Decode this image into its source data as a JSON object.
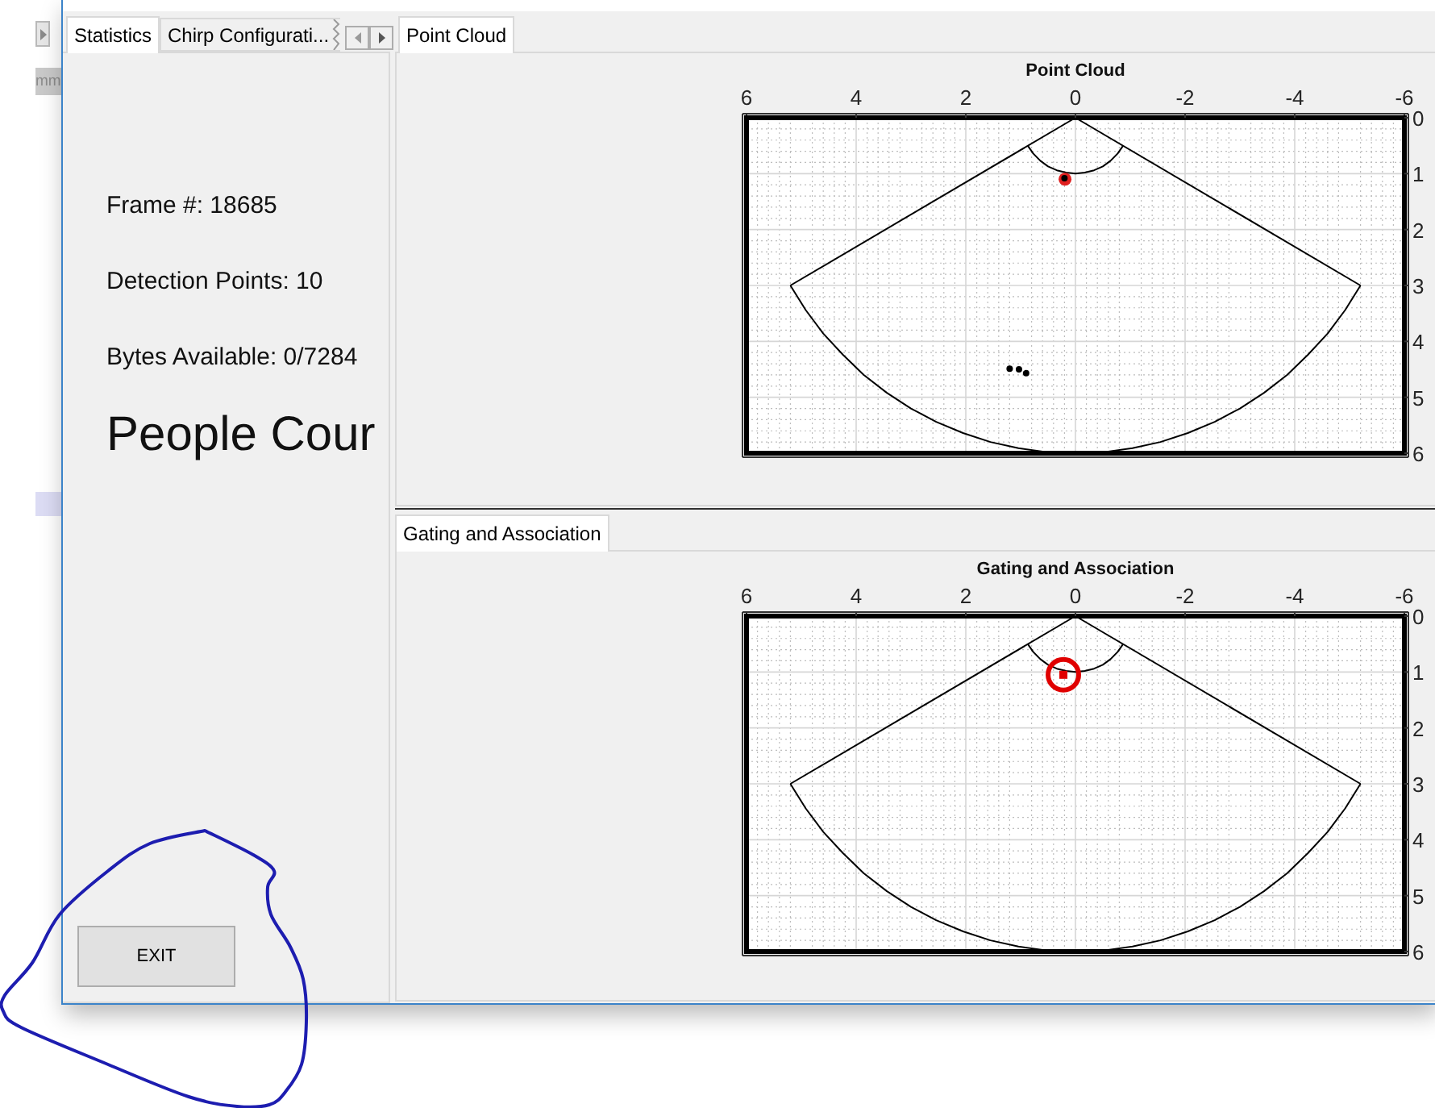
{
  "background_window": {
    "button": {
      "label": "mm"
    },
    "list_row": {
      "selected": true
    }
  },
  "left_panel": {
    "tabs": [
      {
        "label": "Statistics",
        "selected": true,
        "clipped": false
      },
      {
        "label": "Chirp Configurati...",
        "selected": false,
        "clipped": true
      }
    ],
    "stats": [
      {
        "kind": "line",
        "text": "Frame #: 18685"
      },
      {
        "kind": "line",
        "text": "Detection Points: 10"
      },
      {
        "kind": "line",
        "text": "Bytes Available: 0/7284"
      },
      {
        "kind": "heading",
        "text": "People Cour"
      }
    ],
    "exit_button": {
      "label": "EXIT"
    }
  },
  "panels": [
    {
      "tabs": [
        {
          "label": "Point Cloud",
          "selected": true
        }
      ],
      "chart_data": {
        "type": "scatter",
        "title": "Point Cloud",
        "x": [
          0.19,
          1.2,
          1.03,
          0.9,
          0.2,
          0,
          5.2,
          5.2,
          4.92,
          4.6,
          4.24,
          3.86,
          3.44,
          3,
          2.54,
          2.05,
          1.55,
          1.04,
          0.52,
          0,
          -0.52,
          -1.04,
          -1.55,
          -2.05,
          -2.54,
          -3,
          -3.44,
          -3.86,
          -4.24,
          -4.6,
          -4.92,
          -5.2,
          -5.2,
          0,
          0.87,
          0.77,
          0.64,
          0.5,
          0.34,
          0.17,
          0,
          -0.17,
          -0.34,
          -0.5,
          -0.64,
          -0.77,
          -0.87
        ],
        "xlim": [
          6,
          -6
        ],
        "ylim": [
          6,
          0
        ],
        "xticks": [
          6,
          4,
          2,
          0,
          -2,
          -4,
          -6
        ],
        "yticks": [
          0,
          1,
          2,
          3,
          4,
          5,
          6
        ],
        "grid": true,
        "series": [
          {
            "type": "line",
            "color": "#000000",
            "values": [
              null,
              null,
              null,
              null,
              null,
              0,
              3,
              null,
              null,
              null,
              null,
              null,
              null,
              null,
              null,
              null,
              null,
              null,
              null,
              null,
              null,
              null,
              null,
              null,
              null,
              null,
              null,
              null,
              null,
              null,
              null,
              null,
              null,
              null,
              null,
              null,
              null,
              null,
              null,
              null,
              null,
              null,
              null,
              null,
              null,
              null,
              null
            ]
          },
          {
            "type": "line",
            "color": "#000000",
            "values": [
              null,
              null,
              null,
              null,
              null,
              null,
              null,
              3,
              3.44,
              3.86,
              4.24,
              4.6,
              4.92,
              5.2,
              5.44,
              5.64,
              5.8,
              5.91,
              5.98,
              6,
              5.98,
              5.91,
              5.8,
              5.64,
              5.44,
              5.2,
              4.92,
              4.6,
              4.24,
              3.86,
              3.44,
              3,
              null,
              null,
              null,
              null,
              null,
              null,
              null,
              null,
              null,
              null,
              null,
              null,
              null,
              null,
              null
            ]
          },
          {
            "type": "line",
            "color": "#000000",
            "values": [
              null,
              null,
              null,
              null,
              null,
              null,
              null,
              null,
              null,
              null,
              null,
              null,
              null,
              null,
              null,
              null,
              null,
              null,
              null,
              null,
              null,
              null,
              null,
              null,
              null,
              null,
              null,
              null,
              null,
              null,
              null,
              null,
              3,
              0,
              null,
              null,
              null,
              null,
              null,
              null,
              null,
              null,
              null,
              null,
              null,
              null,
              null
            ]
          },
          {
            "type": "line",
            "color": "#000000",
            "values": [
              null,
              null,
              null,
              null,
              null,
              null,
              null,
              null,
              null,
              null,
              null,
              null,
              null,
              null,
              null,
              null,
              null,
              null,
              null,
              null,
              null,
              null,
              null,
              null,
              null,
              null,
              null,
              null,
              null,
              null,
              null,
              null,
              null,
              null,
              0.5,
              0.64,
              0.77,
              0.87,
              0.94,
              0.98,
              1,
              0.98,
              0.94,
              0.87,
              0.77,
              0.64,
              0.5
            ]
          },
          {
            "color": "#e02020",
            "marker": "circle",
            "values": [
              1.1,
              null,
              null,
              null,
              null,
              null,
              null,
              null,
              null,
              null,
              null,
              null,
              null,
              null,
              null,
              null,
              null,
              null,
              null,
              null,
              null,
              null,
              null,
              null,
              null,
              null,
              null,
              null,
              null,
              null,
              null,
              null,
              null,
              null,
              null,
              null,
              null,
              null,
              null,
              null,
              null,
              null,
              null,
              null,
              null,
              null,
              null
            ]
          },
          {
            "color": "#000000",
            "marker": "circle",
            "values": [
              null,
              4.49,
              4.5,
              4.57,
              1.08,
              null,
              null,
              null,
              null,
              null,
              null,
              null,
              null,
              null,
              null,
              null,
              null,
              null,
              null,
              null,
              null,
              null,
              null,
              null,
              null,
              null,
              null,
              null,
              null,
              null,
              null,
              null,
              null,
              null,
              null,
              null,
              null,
              null,
              null,
              null,
              null,
              null,
              null,
              null,
              null,
              null,
              null
            ]
          }
        ]
      }
    },
    {
      "tabs": [
        {
          "label": "Gating and Association",
          "selected": true
        }
      ],
      "chart_data": {
        "type": "scatter",
        "title": "Gating and Association",
        "x": [
          0.22,
          0,
          5.2,
          5.2,
          4.92,
          4.6,
          4.24,
          3.86,
          3.44,
          3,
          2.54,
          2.05,
          1.55,
          1.04,
          0.52,
          0,
          -0.52,
          -1.04,
          -1.55,
          -2.05,
          -2.54,
          -3,
          -3.44,
          -3.86,
          -4.24,
          -4.6,
          -4.92,
          -5.2,
          -5.2,
          0,
          0.87,
          0.77,
          0.64,
          0.5,
          0.34,
          0.17,
          0,
          -0.17,
          -0.34,
          -0.5,
          -0.64,
          -0.77,
          -0.87
        ],
        "xlim": [
          6,
          -6
        ],
        "ylim": [
          6,
          0
        ],
        "xticks": [
          6,
          4,
          2,
          0,
          -2,
          -4,
          -6
        ],
        "yticks": [
          0,
          1,
          2,
          3,
          4,
          5,
          6
        ],
        "grid": true,
        "series": [
          {
            "type": "line",
            "color": "#000000",
            "values": [
              null,
              0,
              3,
              null,
              null,
              null,
              null,
              null,
              null,
              null,
              null,
              null,
              null,
              null,
              null,
              null,
              null,
              null,
              null,
              null,
              null,
              null,
              null,
              null,
              null,
              null,
              null,
              null,
              null,
              null,
              null,
              null,
              null,
              null,
              null,
              null,
              null,
              null,
              null,
              null,
              null,
              null,
              null
            ]
          },
          {
            "type": "line",
            "color": "#000000",
            "values": [
              null,
              null,
              null,
              3,
              3.44,
              3.86,
              4.24,
              4.6,
              4.92,
              5.2,
              5.44,
              5.64,
              5.8,
              5.91,
              5.98,
              6,
              5.98,
              5.91,
              5.8,
              5.64,
              5.44,
              5.2,
              4.92,
              4.6,
              4.24,
              3.86,
              3.44,
              3,
              null,
              null,
              null,
              null,
              null,
              null,
              null,
              null,
              null,
              null,
              null,
              null,
              null,
              null,
              null
            ]
          },
          {
            "type": "line",
            "color": "#000000",
            "values": [
              null,
              null,
              null,
              null,
              null,
              null,
              null,
              null,
              null,
              null,
              null,
              null,
              null,
              null,
              null,
              null,
              null,
              null,
              null,
              null,
              null,
              null,
              null,
              null,
              null,
              null,
              null,
              null,
              3,
              0,
              null,
              null,
              null,
              null,
              null,
              null,
              null,
              null,
              null,
              null,
              null,
              null,
              null
            ]
          },
          {
            "type": "line",
            "color": "#000000",
            "values": [
              null,
              null,
              null,
              null,
              null,
              null,
              null,
              null,
              null,
              null,
              null,
              null,
              null,
              null,
              null,
              null,
              null,
              null,
              null,
              null,
              null,
              null,
              null,
              null,
              null,
              null,
              null,
              null,
              null,
              null,
              0.5,
              0.64,
              0.77,
              0.87,
              0.94,
              0.98,
              1,
              0.98,
              0.94,
              0.87,
              0.77,
              0.64,
              0.5
            ]
          },
          {
            "color": "#e00000",
            "marker": "circle",
            "values": [
              1.05,
              null,
              null,
              null,
              null,
              null,
              null,
              null,
              null,
              null,
              null,
              null,
              null,
              null,
              null,
              null,
              null,
              null,
              null,
              null,
              null,
              null,
              null,
              null,
              null,
              null,
              null,
              null,
              null,
              null,
              null,
              null,
              null,
              null,
              null,
              null,
              null,
              null,
              null,
              null,
              null,
              null,
              null
            ]
          }
        ]
      }
    }
  ]
}
